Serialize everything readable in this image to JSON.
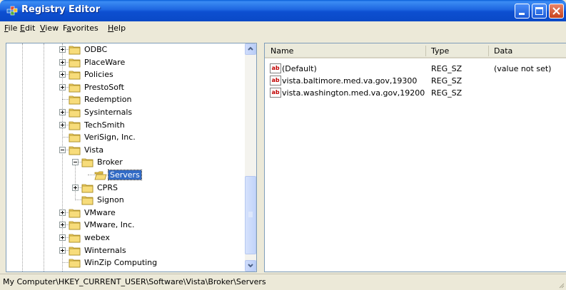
{
  "window": {
    "title": "Registry Editor",
    "icon": "registry-icon",
    "controls": [
      "minimize-icon",
      "maximize-icon",
      "close-icon"
    ]
  },
  "menu": [
    {
      "label": "File",
      "mnemonic": "F"
    },
    {
      "label": "Edit",
      "mnemonic": "E"
    },
    {
      "label": "View",
      "mnemonic": "V"
    },
    {
      "label": "Favorites",
      "mnemonic": "a"
    },
    {
      "label": "Help",
      "mnemonic": "H"
    }
  ],
  "tree": {
    "items": [
      {
        "label": "ODBC",
        "expander": "plus"
      },
      {
        "label": "PlaceWare",
        "expander": "plus"
      },
      {
        "label": "Policies",
        "expander": "plus"
      },
      {
        "label": "PrestoSoft",
        "expander": "plus"
      },
      {
        "label": "Redemption",
        "expander": "none"
      },
      {
        "label": "Sysinternals",
        "expander": "plus"
      },
      {
        "label": "TechSmith",
        "expander": "plus"
      },
      {
        "label": "VeriSign, Inc.",
        "expander": "none"
      },
      {
        "label": "Vista",
        "expander": "minus"
      },
      {
        "label": "Broker",
        "expander": "minus"
      },
      {
        "label": "Servers",
        "expander": "none",
        "selected": true
      },
      {
        "label": "CPRS",
        "expander": "plus"
      },
      {
        "label": "Signon",
        "expander": "none"
      },
      {
        "label": "VMware",
        "expander": "plus"
      },
      {
        "label": "VMware, Inc.",
        "expander": "plus"
      },
      {
        "label": "webex",
        "expander": "plus"
      },
      {
        "label": "Winternals",
        "expander": "plus"
      },
      {
        "label": "WinZip Computing",
        "expander": "none"
      }
    ]
  },
  "list": {
    "columns": [
      "Name",
      "Type",
      "Data"
    ],
    "rows": [
      {
        "icon": "string-value-icon",
        "icon_text": "ab",
        "name": "(Default)",
        "type": "REG_SZ",
        "data": "(value not set)"
      },
      {
        "icon": "string-value-icon",
        "icon_text": "ab",
        "name": "vista.baltimore.med.va.gov,19300",
        "type": "REG_SZ",
        "data": ""
      },
      {
        "icon": "string-value-icon",
        "icon_text": "ab",
        "name": "vista.washington.med.va.gov,19200",
        "type": "REG_SZ",
        "data": ""
      }
    ]
  },
  "status": {
    "path": "My Computer\\HKEY_CURRENT_USER\\Software\\Vista\\Broker\\Servers"
  },
  "colors": {
    "titlebar": "#0a49c6",
    "selection": "#316ac5",
    "folder": "#f4d56c"
  }
}
